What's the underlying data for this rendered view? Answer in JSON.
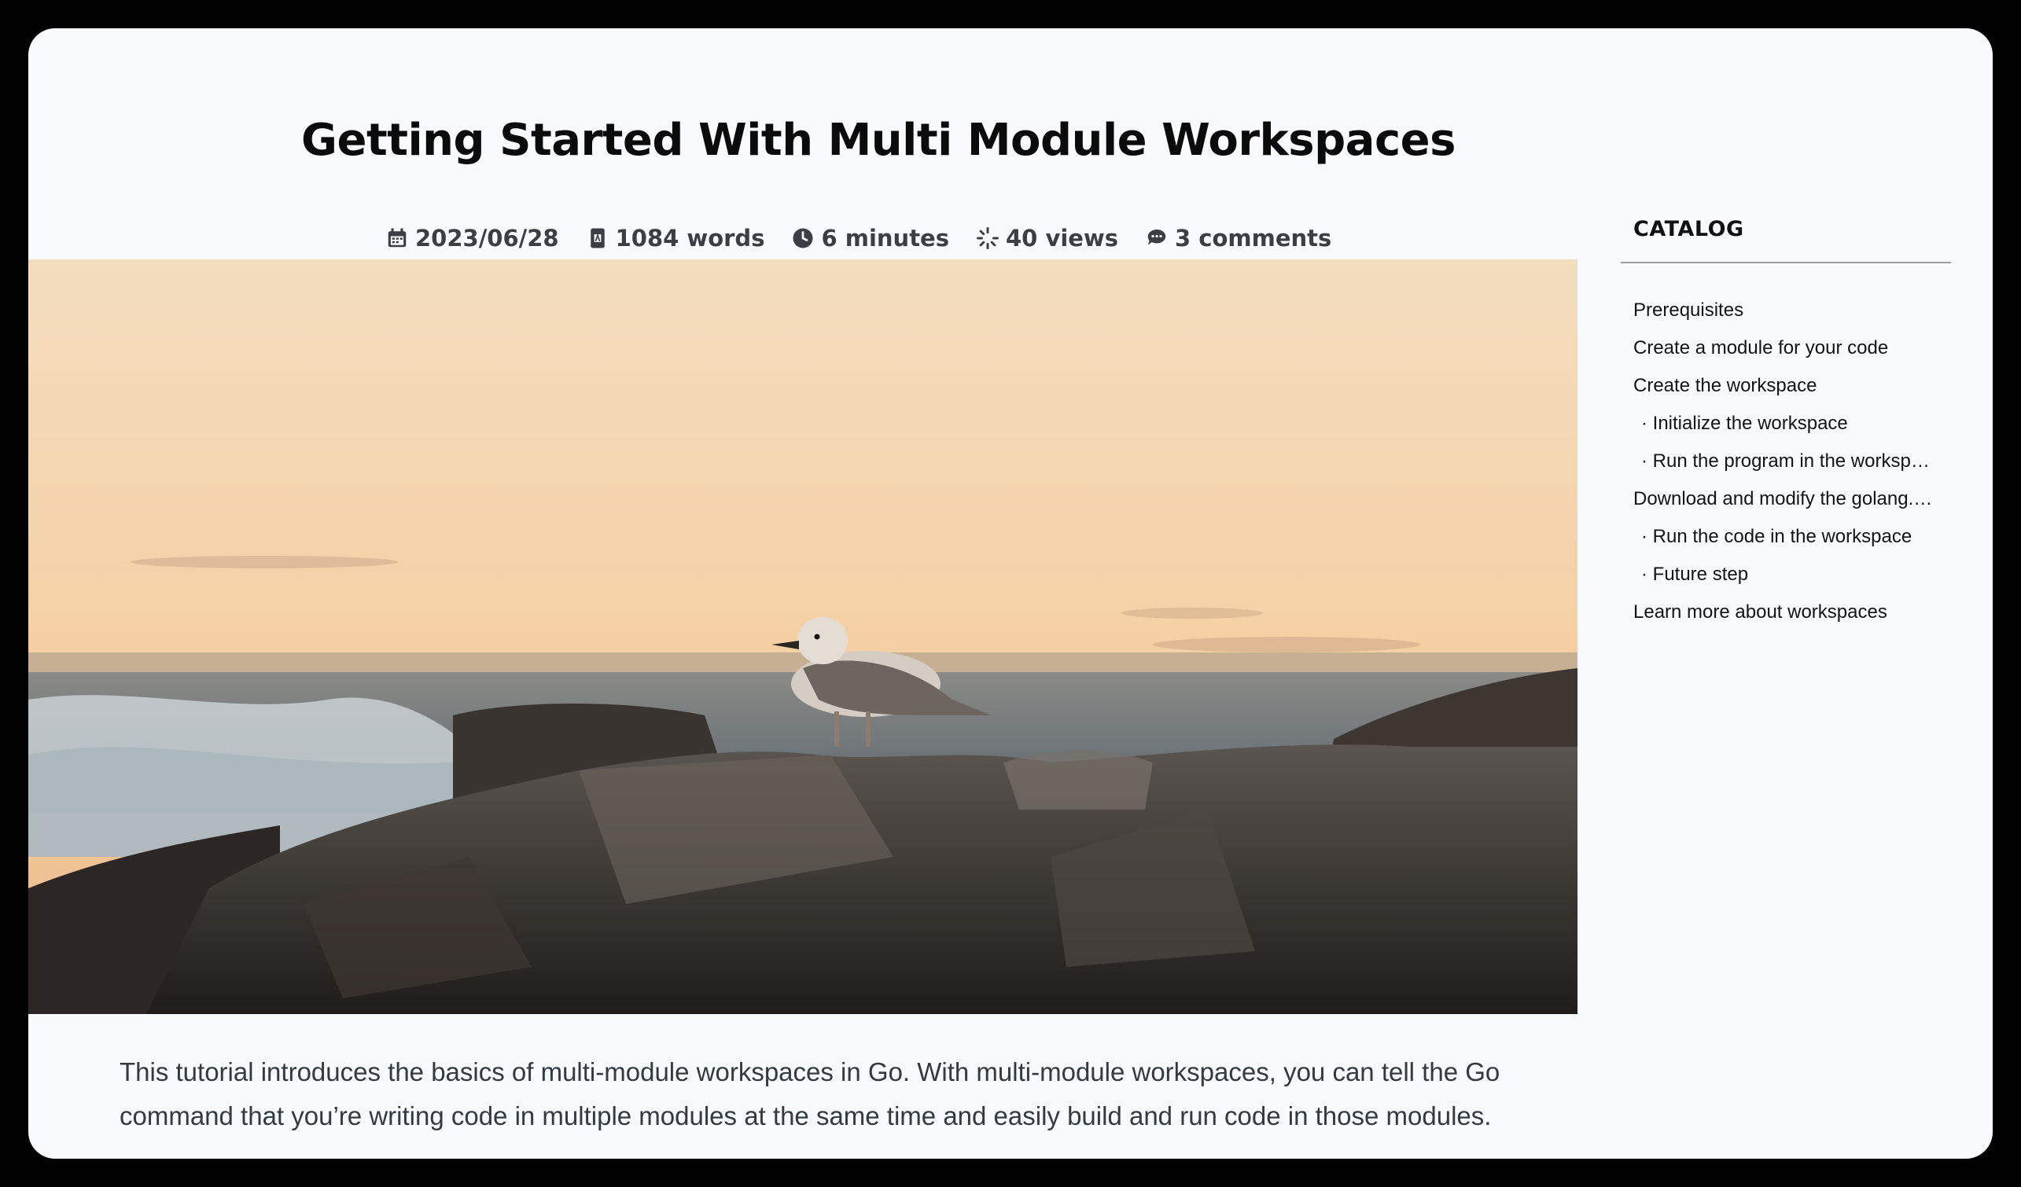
{
  "article": {
    "title": "Getting Started With Multi Module Workspaces",
    "meta": {
      "date": "2023/06/28",
      "words": "1084 words",
      "read_time": "6 minutes",
      "views": "40 views",
      "comments": "3 comments"
    },
    "intro": "This tutorial introduces the basics of multi-module workspaces in Go. With multi-module workspaces, you can tell the Go command that you’re writing code in multiple modules at the same time and easily build and run code in those modules."
  },
  "catalog": {
    "title": "CATALOG",
    "items": [
      {
        "label": "Prerequisites",
        "level": 1
      },
      {
        "label": "Create a module for your code",
        "level": 1
      },
      {
        "label": "Create the workspace",
        "level": 1
      },
      {
        "label": "· Initialize the workspace",
        "level": 2
      },
      {
        "label": "· Run the program in the workspace",
        "level": 2
      },
      {
        "label": "Download and modify the golang.org/x/example module",
        "level": 1
      },
      {
        "label": "· Run the code in the workspace",
        "level": 2
      },
      {
        "label": "· Future step",
        "level": 2
      },
      {
        "label": "Learn more about workspaces",
        "level": 1
      }
    ]
  },
  "icons": {
    "date": "calendar-icon",
    "words": "document-icon",
    "read_time": "clock-icon",
    "views": "spinner-icon",
    "comments": "comments-icon"
  },
  "colors": {
    "page_background": "#f8fafd",
    "frame": "#000000",
    "meta_text": "#3b3f45"
  }
}
